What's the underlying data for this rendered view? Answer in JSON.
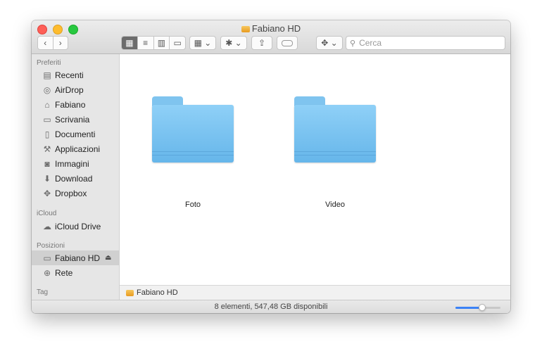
{
  "window": {
    "title": "Fabiano HD",
    "colors": {
      "close": "#fe5f57",
      "minimize": "#febc2e",
      "zoom": "#28c840"
    }
  },
  "toolbar": {
    "back_icon": "chevron-left-icon",
    "back_glyph": "‹",
    "forward_icon": "chevron-right-icon",
    "forward_glyph": "›",
    "view_modes": [
      "icon-view-icon",
      "list-view-icon",
      "column-view-icon",
      "gallery-view-icon"
    ],
    "view_glyphs": [
      "▦",
      "≡",
      "▥",
      "▭"
    ],
    "group_glyph": "▦ ⌄",
    "action_glyph": "✱ ⌄",
    "share_glyph": "⇪",
    "dropbox_glyph": "✥ ⌄",
    "search_icon": "⚲",
    "search_placeholder": "Cerca",
    "active_view_index": 0
  },
  "sidebar": {
    "sections": {
      "favorites": "Preferiti",
      "icloud": "iCloud",
      "locations": "Posizioni",
      "tags": "Tag"
    },
    "favorites": [
      {
        "label": "Recenti",
        "icon": "recents-icon",
        "glyph": "▤"
      },
      {
        "label": "AirDrop",
        "icon": "airdrop-icon",
        "glyph": "◎"
      },
      {
        "label": "Fabiano",
        "icon": "home-icon",
        "glyph": "⌂"
      },
      {
        "label": "Scrivania",
        "icon": "desktop-icon",
        "glyph": "▭"
      },
      {
        "label": "Documenti",
        "icon": "documents-icon",
        "glyph": "▯"
      },
      {
        "label": "Applicazioni",
        "icon": "applications-icon",
        "glyph": "⚒"
      },
      {
        "label": "Immagini",
        "icon": "camera-icon",
        "glyph": "◙"
      },
      {
        "label": "Download",
        "icon": "download-icon",
        "glyph": "⬇"
      },
      {
        "label": "Dropbox",
        "icon": "dropbox-icon",
        "glyph": "✥"
      }
    ],
    "icloud": [
      {
        "label": "iCloud Drive",
        "icon": "cloud-icon",
        "glyph": "☁"
      }
    ],
    "locations": [
      {
        "label": "Fabiano HD",
        "icon": "harddrive-icon",
        "glyph": "▭",
        "selected": true,
        "eject": "⏏"
      },
      {
        "label": "Rete",
        "icon": "network-icon",
        "glyph": "⊕"
      }
    ]
  },
  "content": {
    "items": [
      {
        "name": "Foto",
        "type": "folder"
      },
      {
        "name": "Video",
        "type": "folder"
      }
    ],
    "folder_color": "#7fc4ef"
  },
  "path_bar": {
    "label": "Fabiano HD"
  },
  "status_bar": {
    "text": "8 elementi, 547,48 GB disponibili",
    "icon_size_fraction": 0.6,
    "accent": "#3b82f6"
  }
}
